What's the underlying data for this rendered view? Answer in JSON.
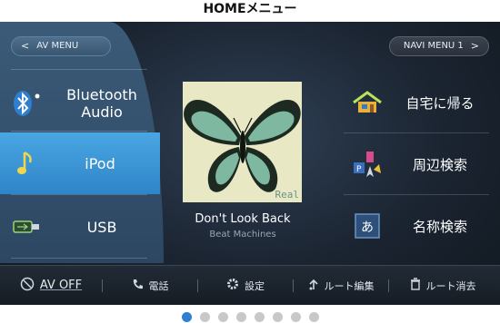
{
  "page": {
    "title": "HOMEメニュー"
  },
  "header": {
    "av_menu_label": "AV MENU",
    "navi_menu_label": "NAVI MENU 1"
  },
  "sources": [
    {
      "label": "Bluetooth Audio",
      "icon": "bluetooth-icon",
      "selected": false
    },
    {
      "label": "iPod",
      "icon": "music-note-icon",
      "selected": true
    },
    {
      "label": "USB",
      "icon": "usb-icon",
      "selected": false
    }
  ],
  "now_playing": {
    "album_text": "Real",
    "song": "Don't Look Back",
    "artist": "Beat Machines"
  },
  "nav_items": [
    {
      "label": "自宅に帰る",
      "icon": "home-icon"
    },
    {
      "label": "周辺検索",
      "icon": "poi-search-icon"
    },
    {
      "label": "名称検索",
      "icon": "name-search-icon",
      "icon_text": "あ"
    }
  ],
  "bottom_bar": {
    "av_off": "AV OFF",
    "phone": "電話",
    "settings": "設定",
    "route_edit": "ルート編集",
    "route_delete": "ルート消去"
  },
  "pagination": {
    "pages": 8,
    "current": 1
  },
  "colors": {
    "accent": "#2f85c8",
    "panel": "#3b5b78",
    "background": "#1b2431"
  }
}
